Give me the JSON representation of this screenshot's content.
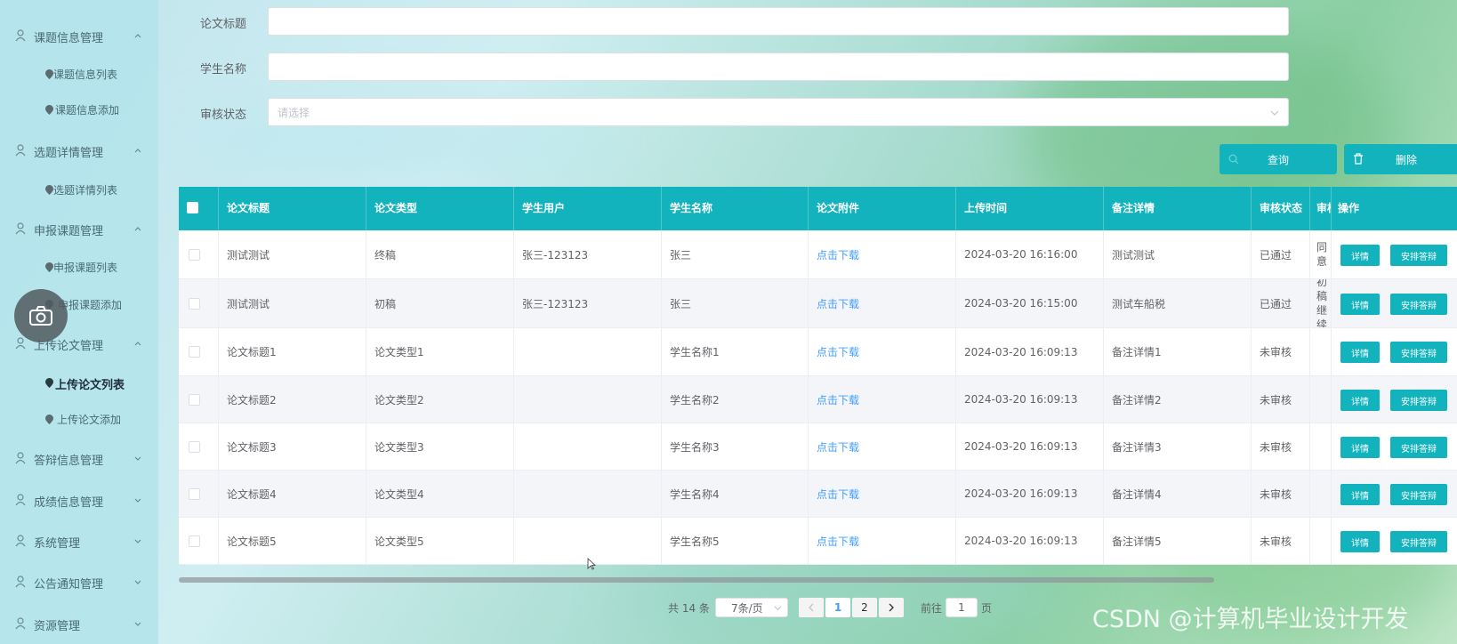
{
  "sidebar": {
    "groups": [
      {
        "label": "课题信息管理",
        "expanded": true,
        "items": [
          "课题信息列表",
          "课题信息添加"
        ]
      },
      {
        "label": "选题详情管理",
        "expanded": true,
        "items": [
          "选题详情列表"
        ]
      },
      {
        "label": "申报课题管理",
        "expanded": true,
        "items": [
          "申报课题列表",
          "申报课题添加"
        ]
      },
      {
        "label": "上传论文管理",
        "expanded": true,
        "items": [
          "上传论文列表",
          "上传论文添加"
        ]
      },
      {
        "label": "答辩信息管理",
        "expanded": false,
        "items": []
      },
      {
        "label": "成绩信息管理",
        "expanded": false,
        "items": []
      },
      {
        "label": "系统管理",
        "expanded": false,
        "items": []
      },
      {
        "label": "公告通知管理",
        "expanded": false,
        "items": []
      },
      {
        "label": "资源管理",
        "expanded": false,
        "items": []
      }
    ],
    "active_item": "上传论文列表"
  },
  "form": {
    "title_label": "论文标题",
    "title_value": "",
    "student_label": "学生名称",
    "student_value": "",
    "status_label": "审核状态",
    "status_placeholder": "请选择"
  },
  "buttons": {
    "query": "查询",
    "delete": "删除"
  },
  "table": {
    "headers": [
      "论文标题",
      "论文类型",
      "学生用户",
      "学生名称",
      "论文附件",
      "上传时间",
      "备注详情",
      "审核状态",
      "审核",
      "操作"
    ],
    "rows": [
      {
        "title": "测试测试",
        "type": "终稿",
        "user": "张三-123123",
        "name": "张三",
        "attach": "点击下载",
        "time": "2024-03-20 16:16:00",
        "remark": "测试测试",
        "status": "已通过",
        "review": "同意"
      },
      {
        "title": "测试测试",
        "type": "初稿",
        "user": "张三-123123",
        "name": "张三",
        "attach": "点击下载",
        "time": "2024-03-20 16:15:00",
        "remark": "测试车船税",
        "status": "已通过",
        "review": "初稿 继续"
      },
      {
        "title": "论文标题1",
        "type": "论文类型1",
        "user": "",
        "name": "学生名称1",
        "attach": "点击下载",
        "time": "2024-03-20 16:09:13",
        "remark": "备注详情1",
        "status": "未审核",
        "review": ""
      },
      {
        "title": "论文标题2",
        "type": "论文类型2",
        "user": "",
        "name": "学生名称2",
        "attach": "点击下载",
        "time": "2024-03-20 16:09:13",
        "remark": "备注详情2",
        "status": "未审核",
        "review": ""
      },
      {
        "title": "论文标题3",
        "type": "论文类型3",
        "user": "",
        "name": "学生名称3",
        "attach": "点击下载",
        "time": "2024-03-20 16:09:13",
        "remark": "备注详情3",
        "status": "未审核",
        "review": ""
      },
      {
        "title": "论文标题4",
        "type": "论文类型4",
        "user": "",
        "name": "学生名称4",
        "attach": "点击下载",
        "time": "2024-03-20 16:09:13",
        "remark": "备注详情4",
        "status": "未审核",
        "review": ""
      },
      {
        "title": "论文标题5",
        "type": "论文类型5",
        "user": "",
        "name": "学生名称5",
        "attach": "点击下载",
        "time": "2024-03-20 16:09:13",
        "remark": "备注详情5",
        "status": "未审核",
        "review": ""
      }
    ],
    "action_detail": "详情",
    "action_arrange": "安排答辩"
  },
  "pagination": {
    "total": "共 14 条",
    "page_size": "7条/页",
    "pages": [
      "1",
      "2"
    ],
    "current": "1",
    "goto_label": "前往",
    "goto_value": "1",
    "page_suffix": "页"
  },
  "watermark": "CSDN @计算机毕业设计开发",
  "colors": {
    "accent": "#12b3bd",
    "link": "#409eff",
    "sidebar_bg": "#b4e4ec"
  }
}
